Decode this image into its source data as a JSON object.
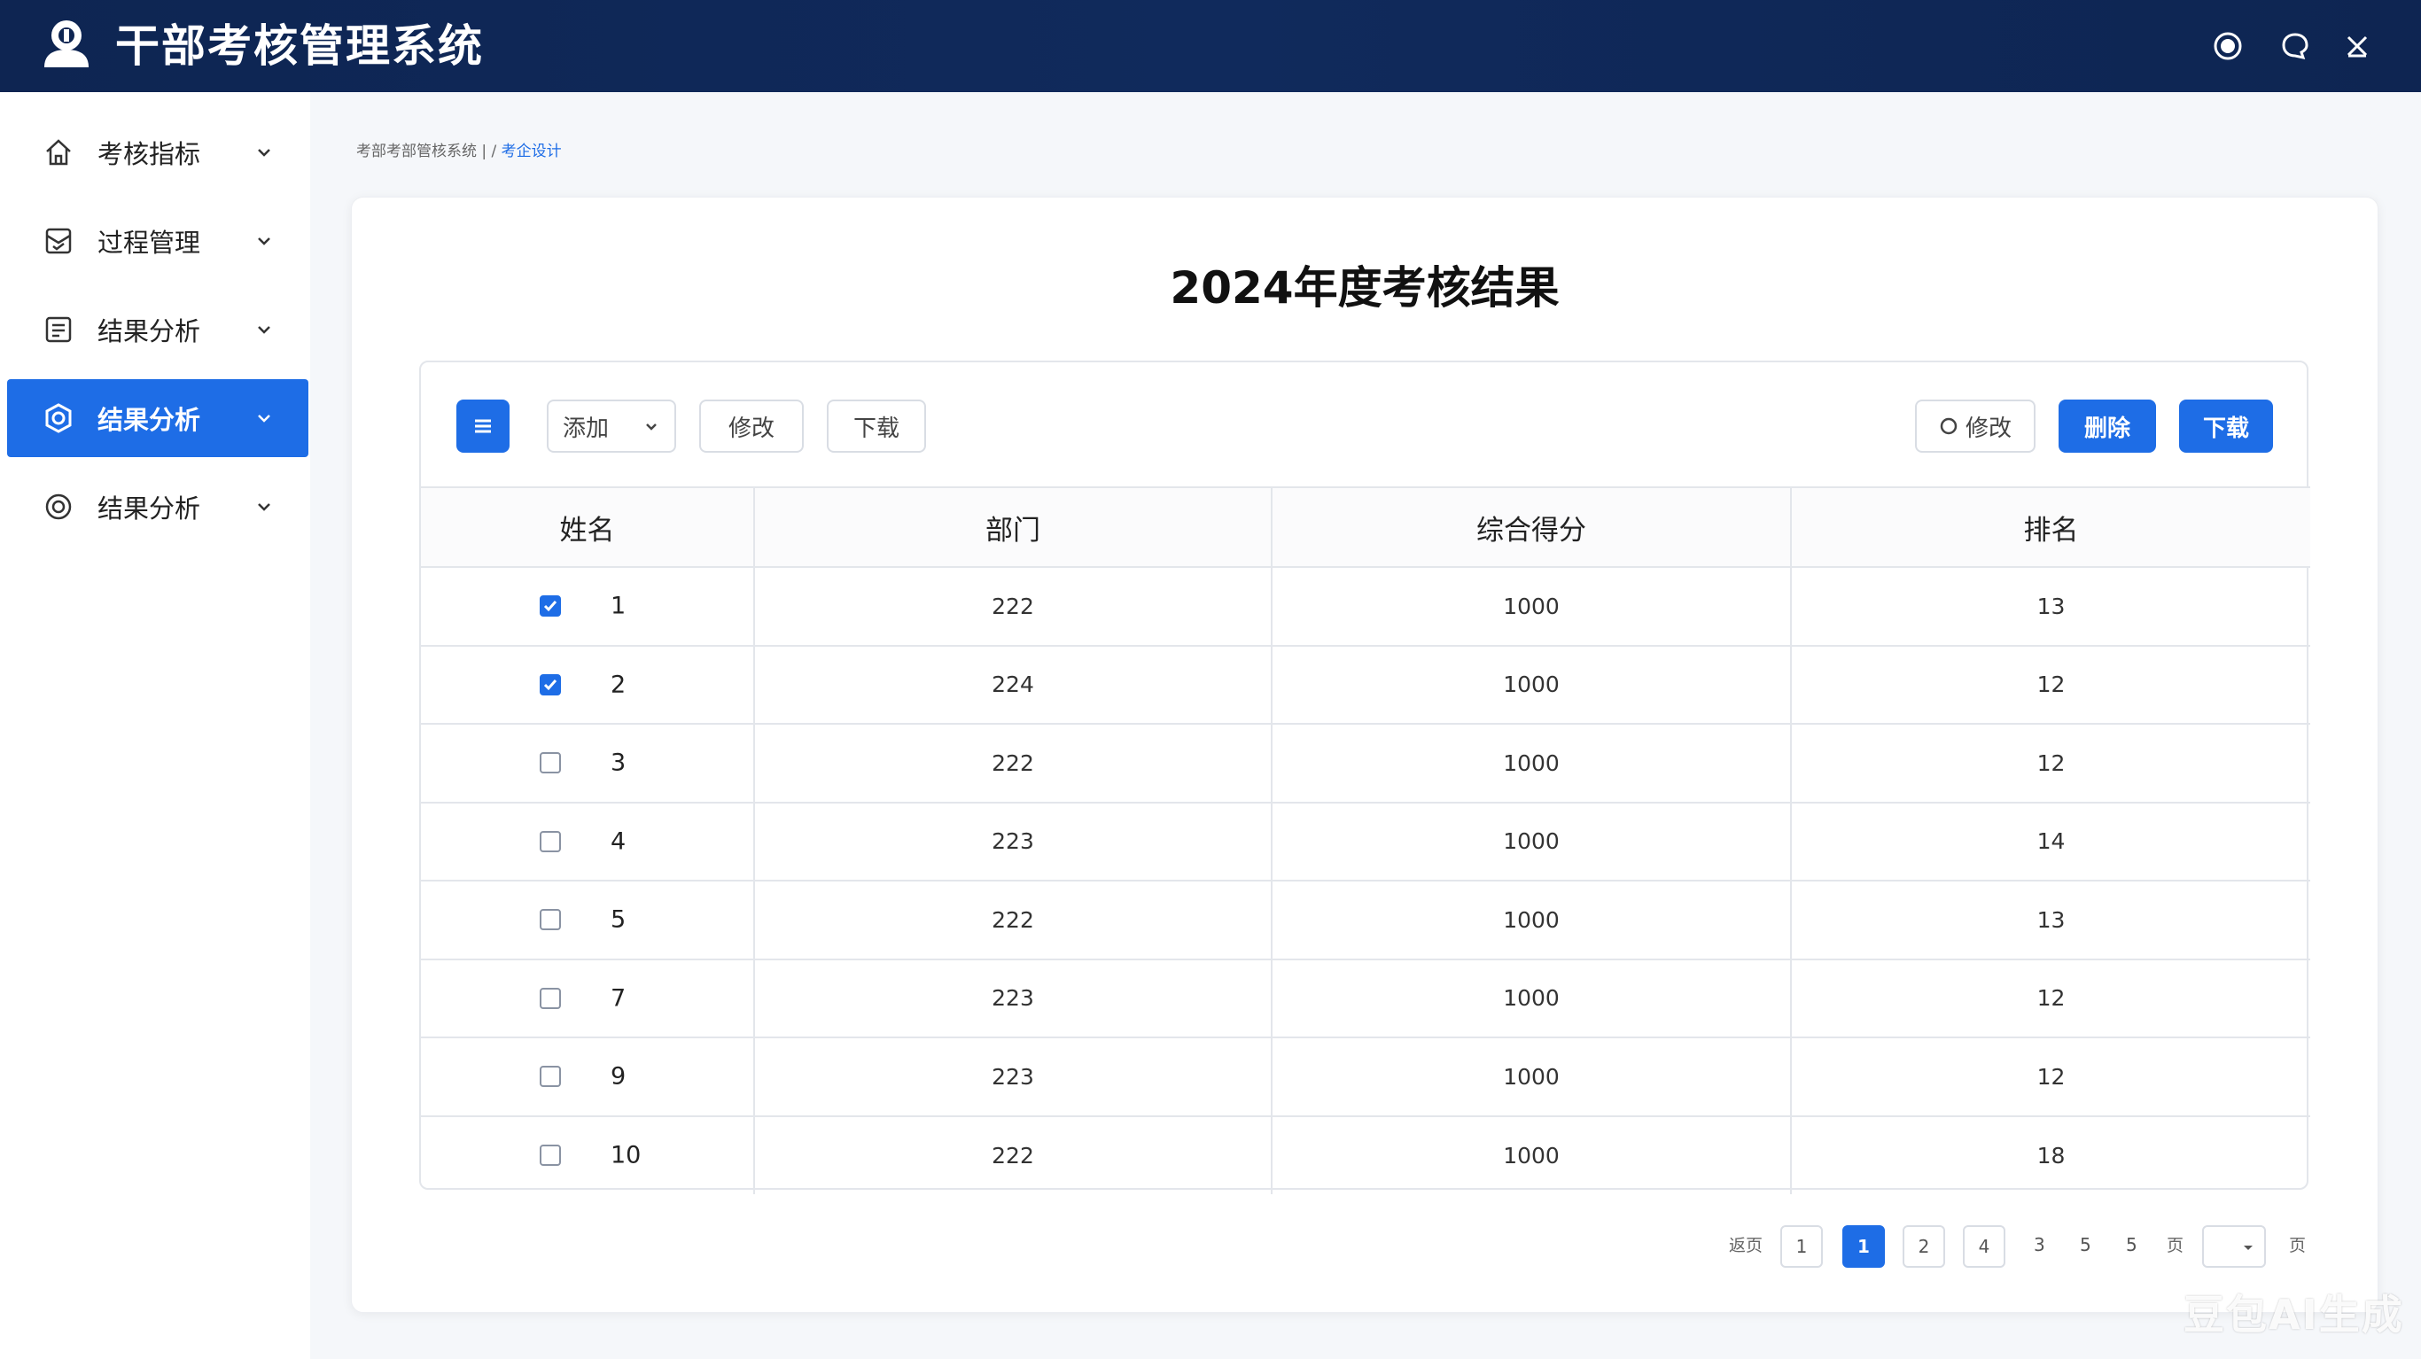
{
  "app": {
    "title": "干部考核管理系统"
  },
  "window_controls": [
    {
      "icon": "record-icon"
    },
    {
      "icon": "chat-icon"
    },
    {
      "icon": "close-icon"
    }
  ],
  "sidebar": {
    "items": [
      {
        "label": "考核指标",
        "icon": "home-icon",
        "active": false
      },
      {
        "label": "过程管理",
        "icon": "mail-check-icon",
        "active": false
      },
      {
        "label": "结果分析",
        "icon": "document-icon",
        "active": false
      },
      {
        "label": "结果分析",
        "icon": "hexagon-icon",
        "active": true
      },
      {
        "label": "结果分析",
        "icon": "target-icon",
        "active": false
      }
    ]
  },
  "breadcrumb": {
    "root": "考部考部管核系统",
    "separator": " | / ",
    "current": "考企设计"
  },
  "card": {
    "title": "2024年度考核结果"
  },
  "toolbar": {
    "add_label": "添加",
    "edit_label": "修改",
    "download_label": "下载",
    "edit2_label": "修改",
    "delete_label": "删除",
    "download2_label": "下载"
  },
  "table": {
    "columns": [
      "姓名",
      "部门",
      "综合得分",
      "排名"
    ],
    "rows": [
      {
        "checked": true,
        "name": "1",
        "dept": "222",
        "score": "1000",
        "rank": "13"
      },
      {
        "checked": true,
        "name": "2",
        "dept": "224",
        "score": "1000",
        "rank": "12"
      },
      {
        "checked": false,
        "name": "3",
        "dept": "222",
        "score": "1000",
        "rank": "12"
      },
      {
        "checked": false,
        "name": "4",
        "dept": "223",
        "score": "1000",
        "rank": "14"
      },
      {
        "checked": false,
        "name": "5",
        "dept": "222",
        "score": "1000",
        "rank": "13"
      },
      {
        "checked": false,
        "name": "7",
        "dept": "223",
        "score": "1000",
        "rank": "12"
      },
      {
        "checked": false,
        "name": "9",
        "dept": "223",
        "score": "1000",
        "rank": "12"
      },
      {
        "checked": false,
        "name": "10",
        "dept": "222",
        "score": "1000",
        "rank": "18"
      }
    ]
  },
  "pagination": {
    "prefix": "返页",
    "boxes": [
      "1",
      "1",
      "2",
      "4"
    ],
    "active_index": 1,
    "numbers": [
      "3",
      "5",
      "5"
    ],
    "page_label": "页",
    "suffix": "页"
  },
  "watermark": "豆包AI生成",
  "colors": {
    "header_bg": "#0e2552",
    "accent": "#1e6de6"
  }
}
